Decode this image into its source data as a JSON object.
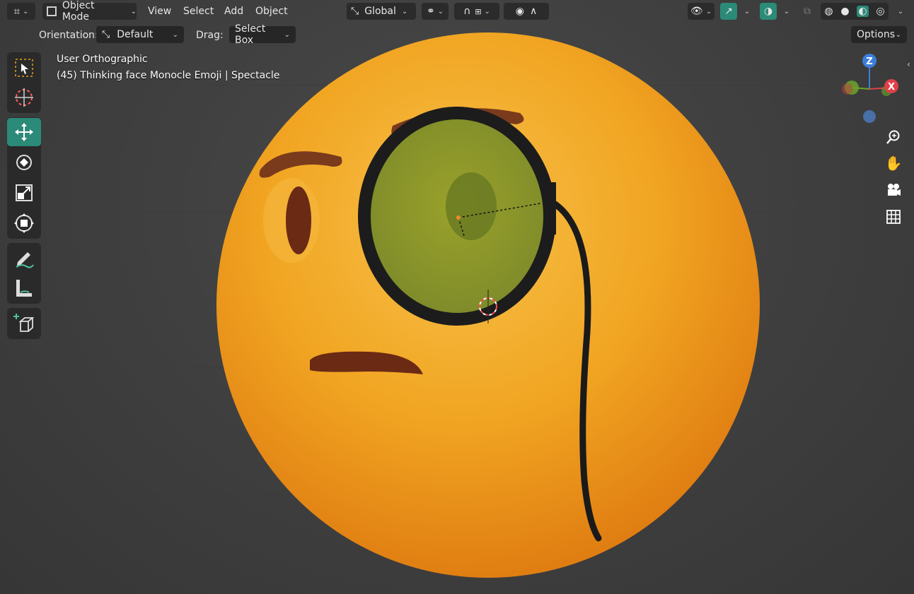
{
  "header": {
    "mode_label": "Object Mode",
    "menus": [
      "View",
      "Select",
      "Add",
      "Object"
    ],
    "transform_orientation": "Global",
    "options_label": "Options"
  },
  "tool_settings": {
    "orientation_label": "Orientation:",
    "orientation_value": "Default",
    "drag_label": "Drag:",
    "drag_value": "Select Box"
  },
  "viewport": {
    "view_name": "User Orthographic",
    "object_info": "(45) Thinking face Monocle Emoji | Spectacle"
  },
  "gizmo": {
    "z_label": "Z",
    "x_label": "X"
  },
  "toolbar": {
    "tools": [
      {
        "name": "select-box-tool",
        "icon": "select-box-icon",
        "active": false
      },
      {
        "name": "cursor-tool",
        "icon": "cursor-icon",
        "active": false
      },
      {
        "name": "move-tool",
        "icon": "move-icon",
        "active": true
      },
      {
        "name": "rotate-tool",
        "icon": "rotate-icon",
        "active": false
      },
      {
        "name": "scale-tool",
        "icon": "scale-icon",
        "active": false
      },
      {
        "name": "transform-tool",
        "icon": "transform-icon",
        "active": false
      },
      {
        "name": "annotate-tool",
        "icon": "annotate-icon",
        "active": false
      },
      {
        "name": "measure-tool",
        "icon": "measure-icon",
        "active": false
      },
      {
        "name": "add-cube-tool",
        "icon": "add-cube-icon",
        "active": false
      }
    ]
  },
  "colors": {
    "accent": "#2c8a78",
    "emoji_yellow": "#f2a723",
    "background": "#404040"
  }
}
